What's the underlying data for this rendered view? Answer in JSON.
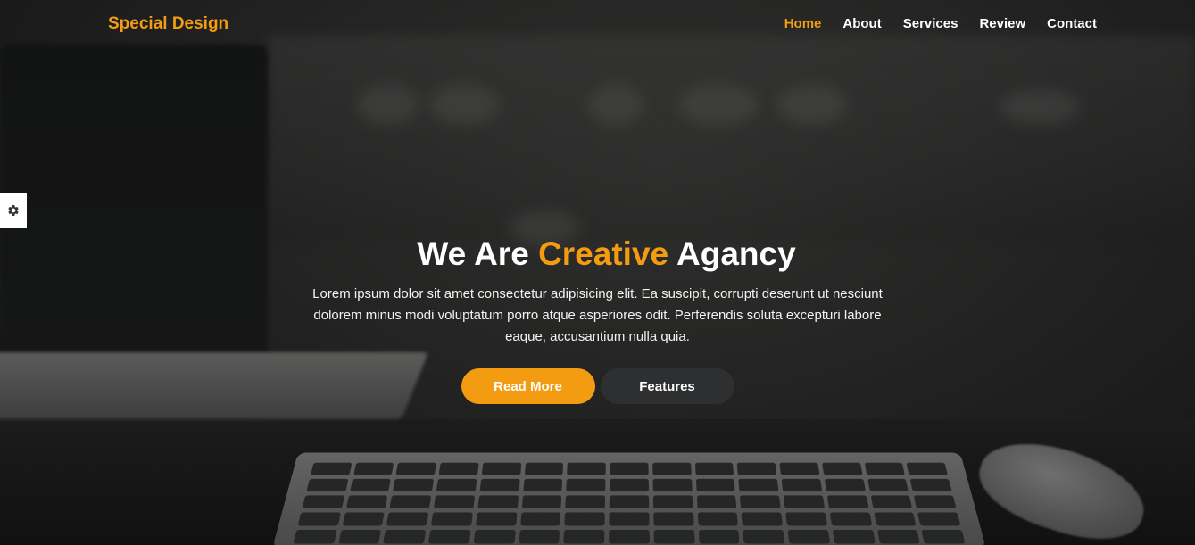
{
  "brand": {
    "logo_text": "Special Design",
    "accent_color": "#f39c12"
  },
  "nav": {
    "items": [
      {
        "label": "Home",
        "active": true
      },
      {
        "label": "About",
        "active": false
      },
      {
        "label": "Services",
        "active": false
      },
      {
        "label": "Review",
        "active": false
      },
      {
        "label": "Contact",
        "active": false
      }
    ]
  },
  "settings": {
    "icon": "gear-icon"
  },
  "hero": {
    "heading_part1": "We Are ",
    "heading_accent": "Creative",
    "heading_part2": " Agancy",
    "description": "Lorem ipsum dolor sit amet consectetur adipisicing elit. Ea suscipit, corrupti deserunt ut nesciunt dolorem minus modi voluptatum porro atque asperiores odit. Perferendis soluta excepturi labore eaque, accusantium nulla quia.",
    "primary_button": "Read More",
    "secondary_button": "Features"
  }
}
